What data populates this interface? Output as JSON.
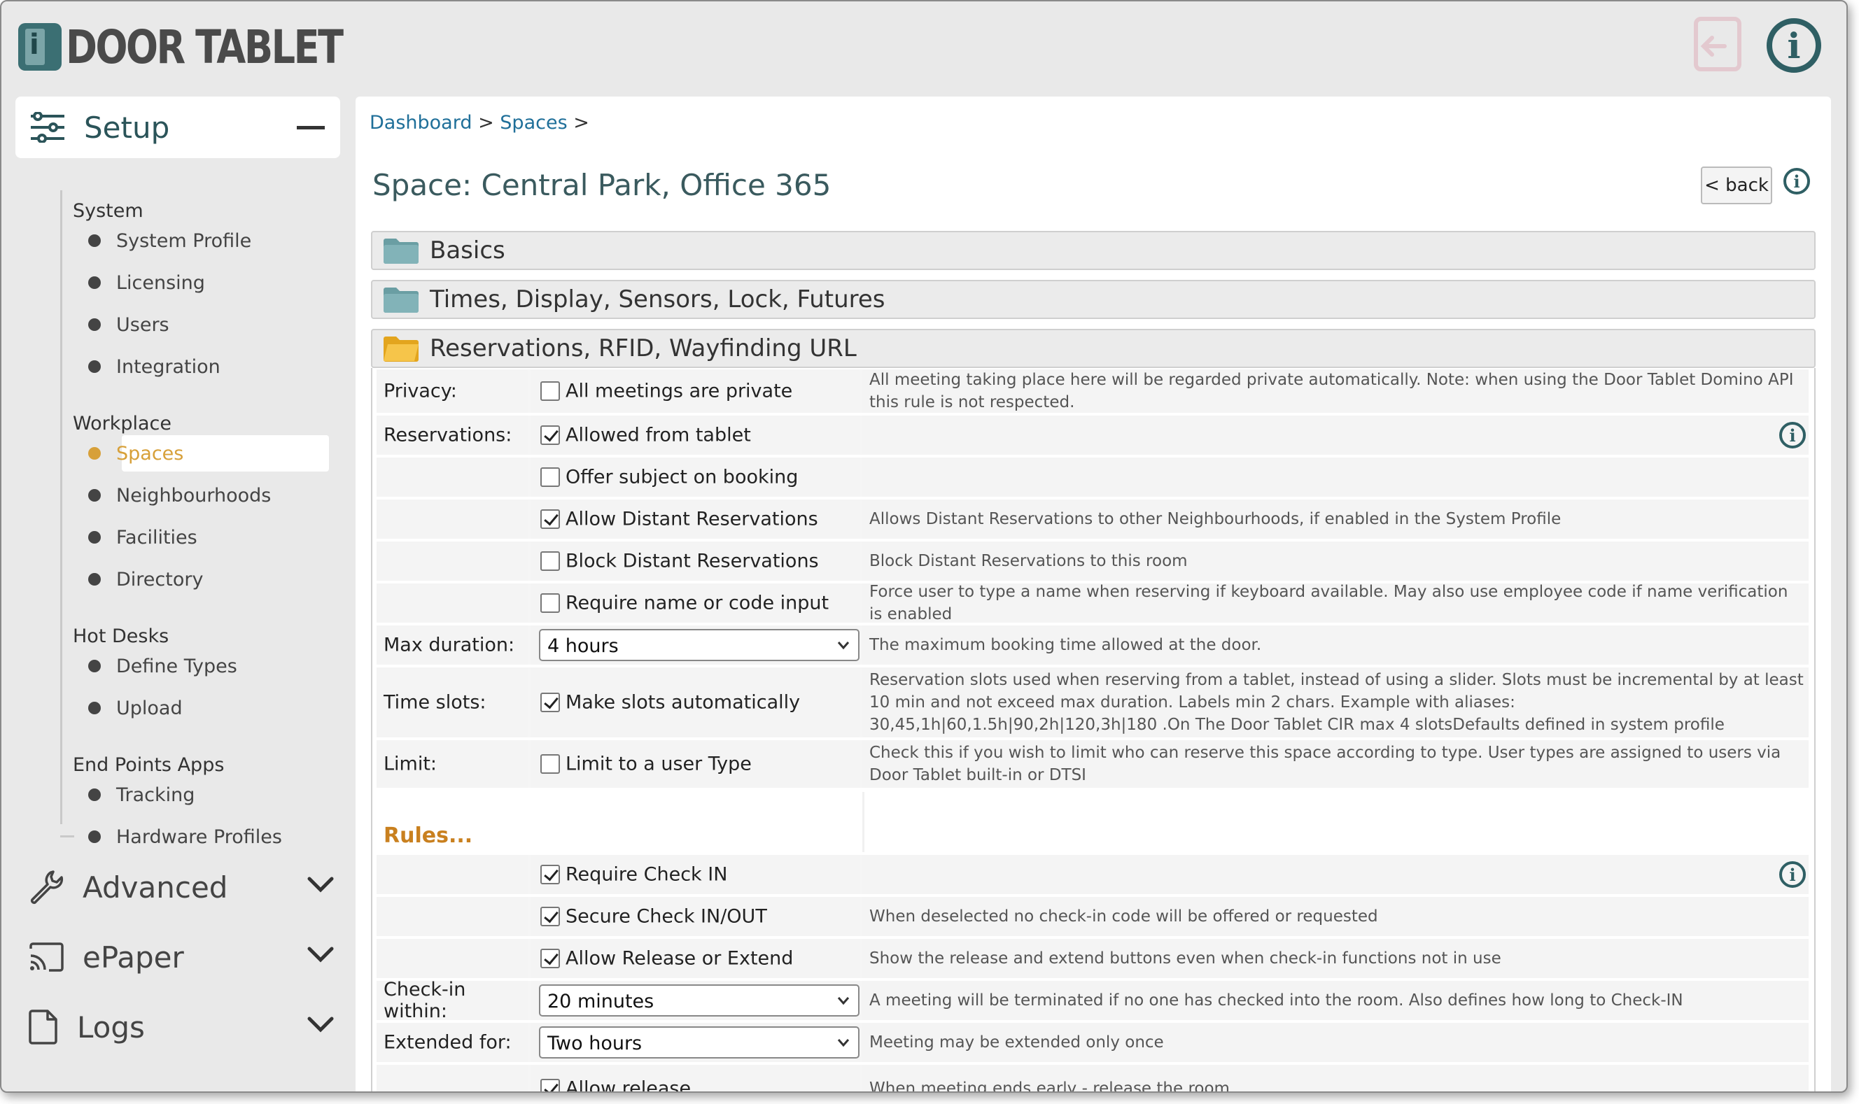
{
  "header": {
    "logo_text": "DOOR TABLET",
    "logout_icon": "logout-icon",
    "info_icon": "info-icon"
  },
  "sidebar": {
    "setup_label": "Setup",
    "groups": [
      {
        "title": "System",
        "items": [
          "System Profile",
          "Licensing",
          "Users",
          "Integration"
        ]
      },
      {
        "title": "Workplace",
        "items": [
          "Spaces",
          "Neighbourhoods",
          "Facilities",
          "Directory"
        ]
      },
      {
        "title": "Hot Desks",
        "items": [
          "Define Types",
          "Upload"
        ]
      },
      {
        "title": "End Points Apps",
        "items": [
          "Tracking",
          "Hardware Profiles"
        ]
      }
    ],
    "active_item": "Spaces",
    "sections": [
      {
        "label": "Advanced",
        "icon": "wrench-icon"
      },
      {
        "label": "ePaper",
        "icon": "cast-icon"
      },
      {
        "label": "Logs",
        "icon": "file-icon"
      }
    ]
  },
  "main": {
    "breadcrumb": {
      "dashboard": "Dashboard",
      "sep": ">",
      "spaces": "Spaces"
    },
    "title": "Space: Central Park, Office 365",
    "back_label": "< back",
    "panels": [
      {
        "label": "Basics",
        "open": false
      },
      {
        "label": "Times, Display, Sensors, Lock, Futures",
        "open": false
      },
      {
        "label": "Reservations, RFID, Wayfinding URL",
        "open": true
      }
    ],
    "rows": {
      "privacy": {
        "label": "Privacy:",
        "check": "All meetings are private",
        "checked": false,
        "desc": "All meeting taking place here will be regarded private automatically. Note: when using the Door Tablet Domino API this rule is not respected."
      },
      "reservations": {
        "label": "Reservations:",
        "check": "Allowed from tablet",
        "checked": true
      },
      "offer_subject": {
        "check": "Offer subject on booking",
        "checked": false
      },
      "allow_distant": {
        "check": "Allow Distant Reservations",
        "checked": true,
        "desc": "Allows Distant Reservations to other Neighbourhoods, if enabled in the System Profile"
      },
      "block_distant": {
        "check": "Block Distant Reservations",
        "checked": false,
        "desc": "Block Distant Reservations to this room"
      },
      "require_name": {
        "check": "Require name or code input",
        "checked": false,
        "desc": "Force user to type a name when reserving if keyboard available.  May also use employee code if name verification is enabled"
      },
      "max_duration": {
        "label": "Max duration:",
        "value": "4 hours",
        "desc": "The maximum booking time allowed at the door."
      },
      "time_slots": {
        "label": "Time slots:",
        "check": "Make slots automatically",
        "checked": true,
        "desc": "Reservation slots used when reserving from a tablet, instead of using a slider. Slots must be incremental by at least 10 min and not exceed max duration. Labels min 2 chars. Example with aliases: 30,45,1h|60,1.5h|90,2h|120,3h|180 .On The Door Tablet CIR max 4 slotsDefaults defined in system profile"
      },
      "limit": {
        "label": "Limit:",
        "check": "Limit to a user Type",
        "checked": false,
        "desc": "Check this if you wish to limit who can reserve this space according to type. User types are assigned to users via Door Tablet built-in or DTSI"
      },
      "rules_heading": "Rules...",
      "require_checkin": {
        "check": "Require Check IN",
        "checked": true
      },
      "secure_checkin": {
        "check": "Secure Check IN/OUT",
        "checked": true,
        "desc": "When deselected no check-in code will be offered or requested"
      },
      "allow_release": {
        "check": "Allow Release or Extend",
        "checked": true,
        "desc": "Show the release and extend buttons even when check-in functions not in use"
      },
      "checkin_within": {
        "label": "Check-in within:",
        "value": "20 minutes",
        "desc": "A meeting will be terminated if no one has checked into the room. Also defines how long to Check-IN"
      },
      "extended_for": {
        "label": "Extended for:",
        "value": "Two hours",
        "desc": "Meeting may be extended only once"
      },
      "allow_release2": {
        "check": "Allow release",
        "checked": true,
        "desc": "When meeting ends early - release the room"
      }
    }
  }
}
